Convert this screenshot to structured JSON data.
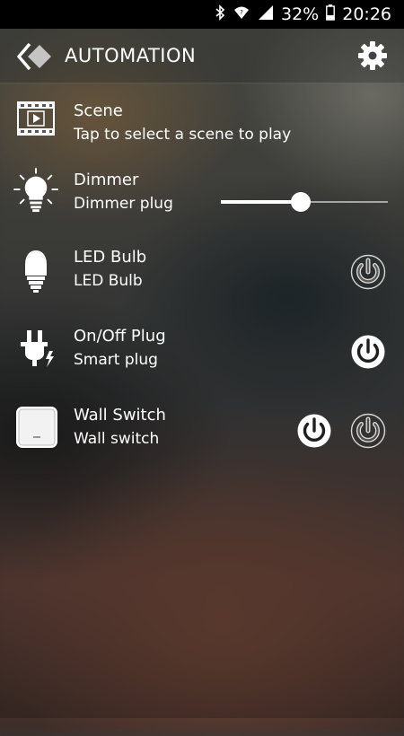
{
  "status_bar": {
    "bluetooth_icon": "bluetooth-icon",
    "wifi_icon": "wifi-icon",
    "signal_icon": "signal-icon",
    "battery_percent": "32%",
    "battery_icon": "battery-icon",
    "time": "20:26"
  },
  "app_bar": {
    "title": "AUTOMATION",
    "back_icon": "back-icon",
    "settings_icon": "gear-icon"
  },
  "devices": [
    {
      "title": "Scene",
      "subtitle": "Tap to select a scene to play",
      "icon": "film-icon"
    },
    {
      "title": "Dimmer",
      "subtitle": "Dimmer plug",
      "icon": "light-bulb-icon",
      "level": 0.48
    },
    {
      "title": "LED Bulb",
      "subtitle": "LED Bulb",
      "icon": "led-bulb-icon",
      "power": "off"
    },
    {
      "title": "On/Off Plug",
      "subtitle": "Smart plug",
      "icon": "plug-icon",
      "power": "on"
    },
    {
      "title": "Wall Switch",
      "subtitle": "Wall switch",
      "icon": "wall-switch-icon",
      "power_buttons": [
        "on",
        "off"
      ]
    }
  ]
}
